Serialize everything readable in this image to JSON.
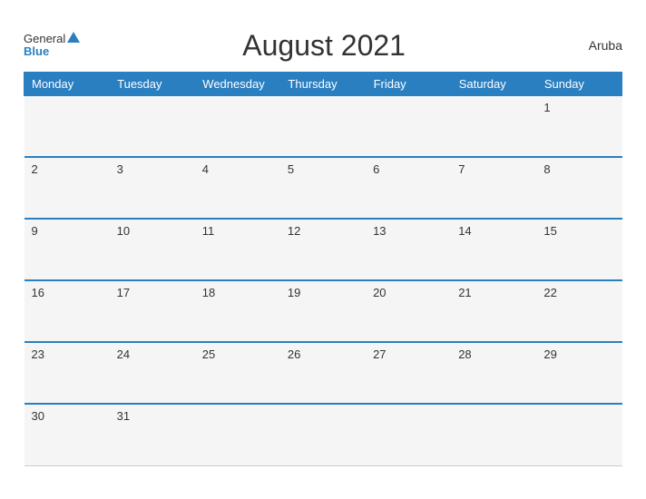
{
  "header": {
    "logo_general": "General",
    "logo_blue": "Blue",
    "title": "August 2021",
    "region": "Aruba"
  },
  "weekdays": [
    "Monday",
    "Tuesday",
    "Wednesday",
    "Thursday",
    "Friday",
    "Saturday",
    "Sunday"
  ],
  "weeks": [
    [
      null,
      null,
      null,
      null,
      null,
      null,
      1
    ],
    [
      2,
      3,
      4,
      5,
      6,
      7,
      8
    ],
    [
      9,
      10,
      11,
      12,
      13,
      14,
      15
    ],
    [
      16,
      17,
      18,
      19,
      20,
      21,
      22
    ],
    [
      23,
      24,
      25,
      26,
      27,
      28,
      29
    ],
    [
      30,
      31,
      null,
      null,
      null,
      null,
      null
    ]
  ]
}
